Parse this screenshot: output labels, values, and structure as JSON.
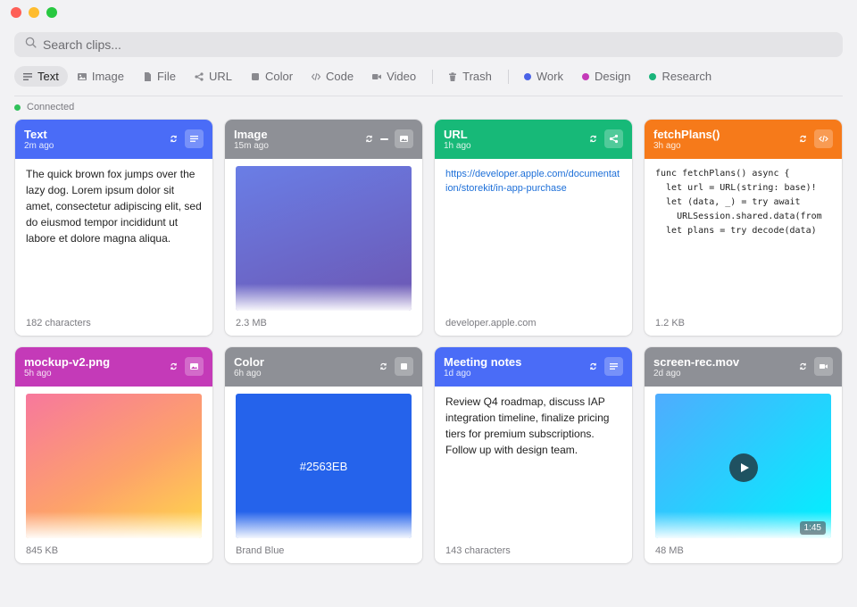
{
  "search": {
    "placeholder": "Search clips..."
  },
  "filters": [
    {
      "label": "Text",
      "icon": "text-lines-icon",
      "active": true
    },
    {
      "label": "Image",
      "icon": "image-icon"
    },
    {
      "label": "File",
      "icon": "file-icon"
    },
    {
      "label": "URL",
      "icon": "share-icon"
    },
    {
      "label": "Color",
      "icon": "color-swatch-icon"
    },
    {
      "label": "Code",
      "icon": "code-icon"
    },
    {
      "label": "Video",
      "icon": "video-icon"
    },
    {
      "label": "Trash",
      "icon": "trash-icon"
    }
  ],
  "collections": [
    {
      "label": "Work",
      "color": "#4a63e7"
    },
    {
      "label": "Design",
      "color": "#c43ab8"
    },
    {
      "label": "Research",
      "color": "#19b47a"
    }
  ],
  "status": {
    "label": "Connected",
    "color": "#30c15a"
  },
  "cards": [
    {
      "title": "Text",
      "time": "2m ago",
      "color": "#4a6cf7",
      "type": "text-icon",
      "body": "The quick brown fox jumps over the lazy dog. Lorem ipsum dolor sit amet, consectetur adipiscing elit, sed do eiusmod tempor incididunt ut labore et dolore magna aliqua.",
      "footer": "182 characters"
    },
    {
      "title": "Image",
      "time": "15m ago",
      "color": "#8e9096",
      "type": "image-icon",
      "footer": "2.3 MB"
    },
    {
      "title": "URL",
      "time": "1h ago",
      "color": "#17b978",
      "type": "share-icon",
      "body": "https://developer.apple.com/documentation/storekit/in-app-purchase",
      "footer": "developer.apple.com"
    },
    {
      "title": "fetchPlans()",
      "time": "3h ago",
      "color": "#f67a1a",
      "type": "code-icon",
      "body": "func fetchPlans() async {\n  let url = URL(string: base)!\n  let (data, _) = try await\n    URLSession.shared.data(from\n  let plans = try decode(data)",
      "footer": "1.2 KB"
    },
    {
      "title": "mockup-v2.png",
      "time": "5h ago",
      "color": "#c43ab8",
      "type": "image-icon",
      "footer": "845 KB"
    },
    {
      "title": "Color",
      "time": "6h ago",
      "color": "#8e9096",
      "type": "color-swatch-icon",
      "hex": "#2563EB",
      "footer": "Brand Blue"
    },
    {
      "title": "Meeting notes",
      "time": "1d ago",
      "color": "#4a6cf7",
      "type": "text-icon",
      "body": "Review Q4 roadmap, discuss IAP integration timeline, finalize pricing tiers for premium subscriptions. Follow up with design team.",
      "footer": "143 characters"
    },
    {
      "title": "screen-rec.mov",
      "time": "2d ago",
      "color": "#8e9096",
      "type": "video-icon",
      "duration": "1:45",
      "footer": "48 MB"
    }
  ]
}
